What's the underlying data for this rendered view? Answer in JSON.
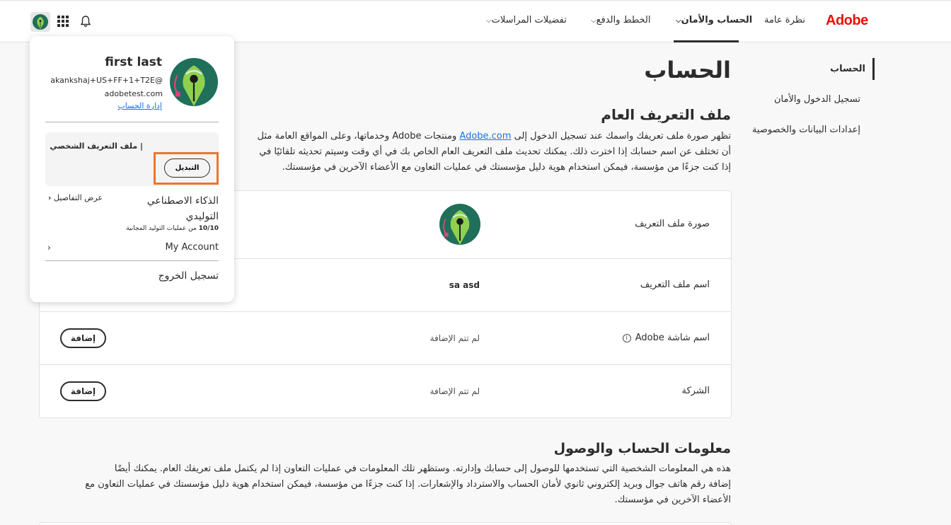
{
  "header": {
    "logo": "Adobe",
    "nav": [
      {
        "label": "نظرة عامة"
      },
      {
        "label": "الحساب والأمان"
      },
      {
        "label": "الخطط والدفع"
      },
      {
        "label": "تفضيلات المراسلات"
      }
    ]
  },
  "sidebar": {
    "items": [
      {
        "label": "الحساب"
      },
      {
        "label": "تسجيل الدخول والأمان"
      },
      {
        "label": "إعدادات البيانات والخصوصية"
      }
    ]
  },
  "main": {
    "title": "الحساب",
    "profile_section": {
      "title": "ملف التعريف العام",
      "desc_part1": "تظهر صورة ملف تعريفك واسمك عند تسجيل الدخول إلى ",
      "desc_link": "Adobe.com",
      "desc_part2": " ومنتجات Adobe وخدماتها، وعلى المواقع العامة مثل ",
      "desc_line2": "أن تختلف عن اسم حسابك إذا اخترت ذلك. يمكنك تحديث ملف التعريف العام الخاص بك في أي وقت وسيتم تحديثه تلقائيًا في",
      "desc_line3": "إذا كنت جزءًا من مؤسسة، فيمكن استخدام هوية دليل مؤسستك في عمليات التعاون مع الأعضاء الآخرين في مؤسستك.",
      "rows": [
        {
          "label": "صورة ملف التعريف"
        },
        {
          "label": "اسم ملف التعريف",
          "value": "sa asd"
        },
        {
          "label": "اسم شاشة Adobe",
          "value": "لم تتم الإضافة",
          "button": "إضافة"
        },
        {
          "label": "الشركة",
          "value": "لم تتم الإضافة",
          "button": "إضافة"
        }
      ]
    },
    "account_section": {
      "title": "معلومات الحساب والوصول",
      "line1": "هذه هي المعلومات الشخصية التي تستخدمها للوصول إلى حسابك وإدارته. وستظهر تلك المعلومات في عمليات التعاون إذا لم يكتمل ملف تعريفك العام. يمكنك أيضًا",
      "line2": "إضافة رقم هاتف جوال وبريد إلكتروني ثانوي لأمان الحساب والاسترداد والإشعارات. إذا كنت جزءًا من مؤسسة، فيمكن استخدام هوية دليل مؤسستك في عمليات التعاون مع",
      "line3": "الأعضاء الآخرين في مؤسستك."
    }
  },
  "profile_panel": {
    "name": "first last",
    "email": "akankshaj+US+FF+1+T2E@adobetest.com",
    "manage_account": "إدارة الحساب",
    "profile_label": "| ملف التعريف الشخصي",
    "switch_label": "التبديل",
    "genai_title": "الذكاء الاصطناعي التوليدي",
    "genai_details": "عرض التفاصيل",
    "genai_count": "10/10",
    "genai_count_suffix": " من عمليات التوليد المجانية",
    "my_account": "My Account",
    "sign_out": "تسجيل الخروج"
  },
  "colors": {
    "brand": "#eb1000",
    "link": "#1473e6",
    "highlight": "#e8772e",
    "avatar_bg": "#1f6f5a",
    "avatar_pen": "#8fd14f"
  }
}
